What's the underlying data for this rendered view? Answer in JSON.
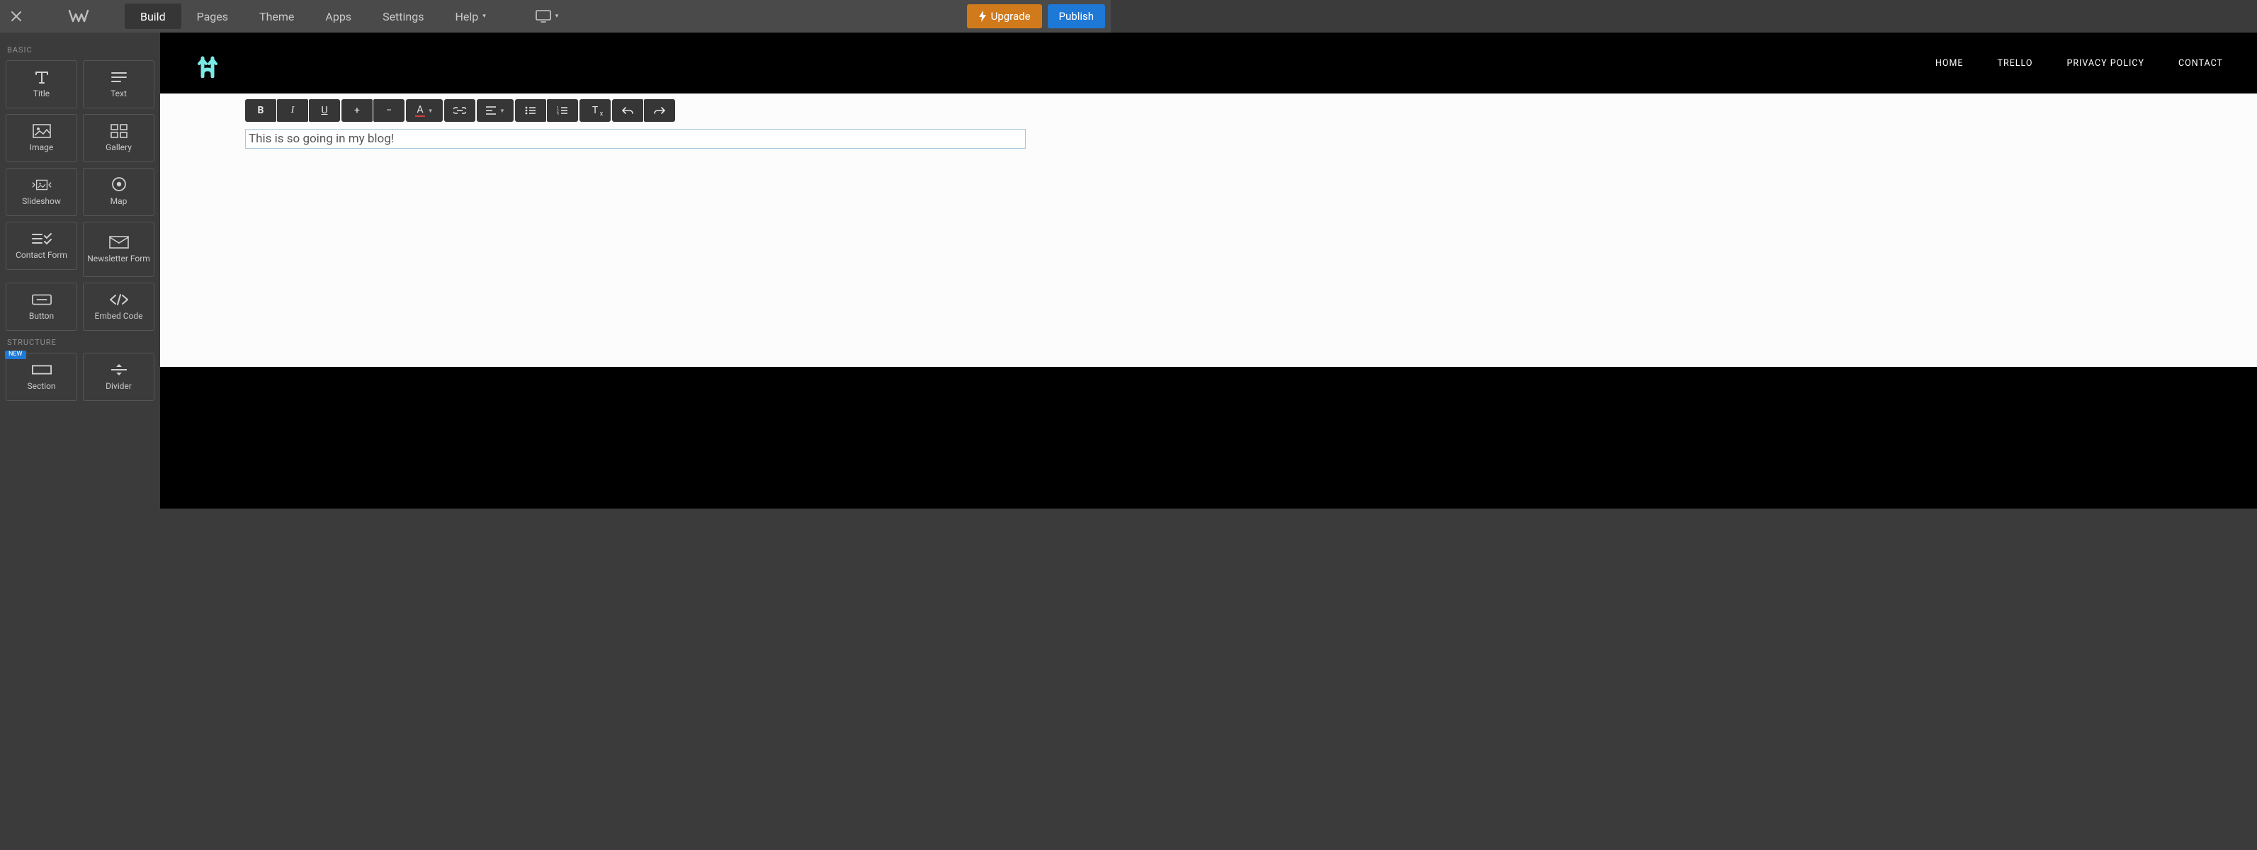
{
  "topnav": {
    "items": [
      {
        "label": "Build",
        "active": true
      },
      {
        "label": "Pages"
      },
      {
        "label": "Theme"
      },
      {
        "label": "Apps"
      },
      {
        "label": "Settings"
      },
      {
        "label": "Help",
        "caret": true
      }
    ],
    "upgrade": "Upgrade",
    "publish": "Publish"
  },
  "sidebar": {
    "sections": [
      {
        "label": "BASIC",
        "tiles": [
          {
            "name": "title",
            "label": "Title",
            "icon": "title-icon"
          },
          {
            "name": "text",
            "label": "Text",
            "icon": "text-icon"
          },
          {
            "name": "image",
            "label": "Image",
            "icon": "image-icon"
          },
          {
            "name": "gallery",
            "label": "Gallery",
            "icon": "gallery-icon"
          },
          {
            "name": "slideshow",
            "label": "Slideshow",
            "icon": "slideshow-icon"
          },
          {
            "name": "map",
            "label": "Map",
            "icon": "map-icon"
          },
          {
            "name": "contact-form",
            "label": "Contact Form",
            "icon": "form-icon"
          },
          {
            "name": "newsletter-form",
            "label": "Newsletter Form",
            "icon": "mail-icon"
          },
          {
            "name": "button",
            "label": "Button",
            "icon": "button-icon"
          },
          {
            "name": "embed-code",
            "label": "Embed Code",
            "icon": "code-icon"
          }
        ]
      },
      {
        "label": "STRUCTURE",
        "tiles": [
          {
            "name": "section",
            "label": "Section",
            "icon": "section-icon",
            "badge": "NEW"
          },
          {
            "name": "divider",
            "label": "Divider",
            "icon": "divider-icon"
          }
        ]
      }
    ]
  },
  "site": {
    "nav": [
      "HOME",
      "TRELLO",
      "PRIVACY POLICY",
      "CONTACT"
    ]
  },
  "editor": {
    "content": "This is so going in my blog!"
  }
}
